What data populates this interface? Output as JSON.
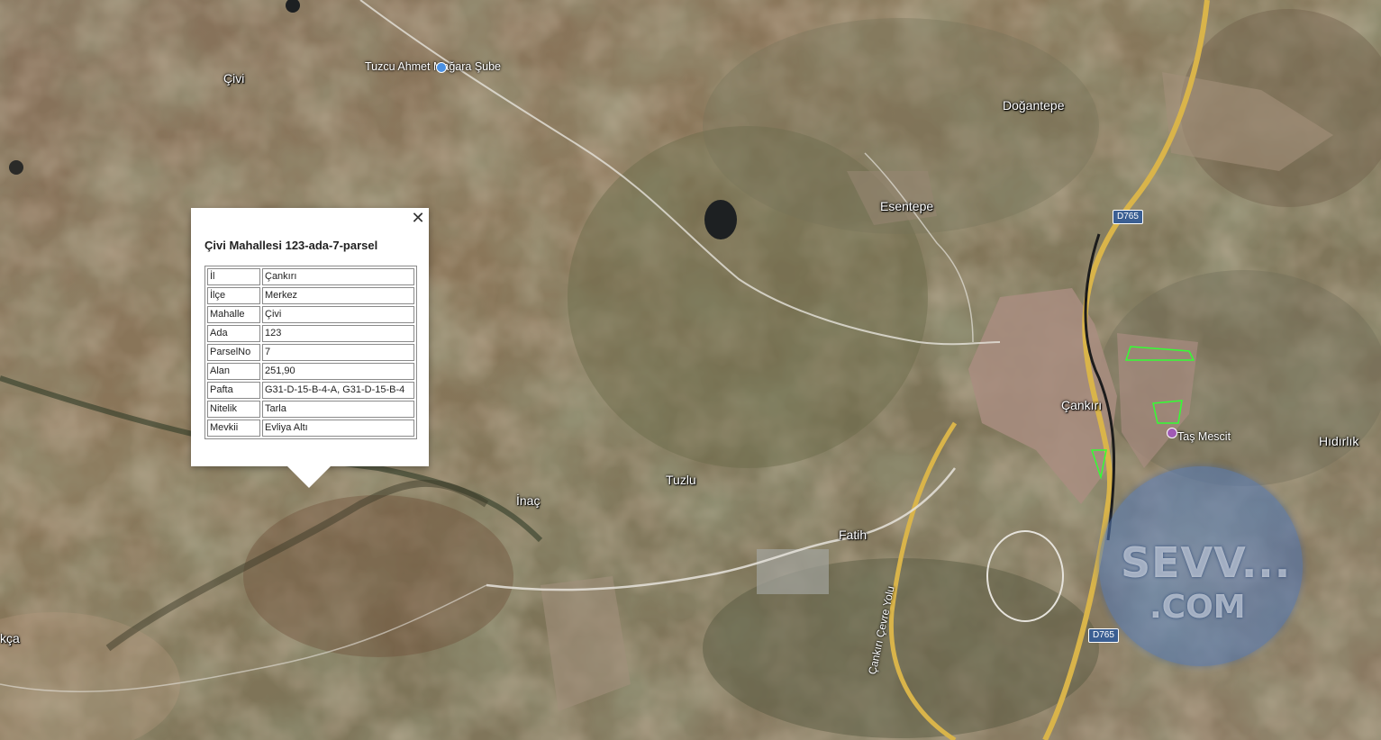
{
  "map": {
    "places": [
      {
        "name": "Çivi",
        "type": "village"
      },
      {
        "name": "Doğantepe",
        "type": "village"
      },
      {
        "name": "Esentepe",
        "type": "village"
      },
      {
        "name": "Çankırı",
        "type": "city"
      },
      {
        "name": "Hıdırlık",
        "type": "village"
      },
      {
        "name": "Tuzlu",
        "type": "village"
      },
      {
        "name": "İnaç",
        "type": "village"
      },
      {
        "name": "Fatih",
        "type": "neighborhood"
      },
      {
        "name": "kça",
        "type": "village-partial"
      }
    ],
    "pois": [
      {
        "name": "Tuzcu Ahmet Mağara Şube",
        "icon": "blue-pin-icon",
        "color": "#4a90e2"
      },
      {
        "name": "Taş Mescit",
        "icon": "purple-pin-icon",
        "color": "#a05ab4"
      }
    ],
    "roads": [
      {
        "label": "D765"
      },
      {
        "label": "D765"
      },
      {
        "label": "Çankırı Çevre Yolu"
      }
    ]
  },
  "popup": {
    "title": "Çivi Mahallesi 123-ada-7-parsel",
    "close_icon": "close-icon",
    "rows": [
      {
        "key": "İl",
        "value": "Çankırı"
      },
      {
        "key": "İlçe",
        "value": "Merkez"
      },
      {
        "key": "Mahalle",
        "value": "Çivi"
      },
      {
        "key": "Ada",
        "value": "123"
      },
      {
        "key": "ParselNo",
        "value": "7"
      },
      {
        "key": "Alan",
        "value": "251,90"
      },
      {
        "key": "Pafta",
        "value": "G31-D-15-B-4-A, G31-D-15-B-4"
      },
      {
        "key": "Nitelik",
        "value": "Tarla"
      },
      {
        "key": "Mevkii",
        "value": "Evliya Altı"
      }
    ]
  },
  "watermark": {
    "line1": "SEVV...",
    "line2": ".COM",
    "color": "#5a82c0"
  }
}
